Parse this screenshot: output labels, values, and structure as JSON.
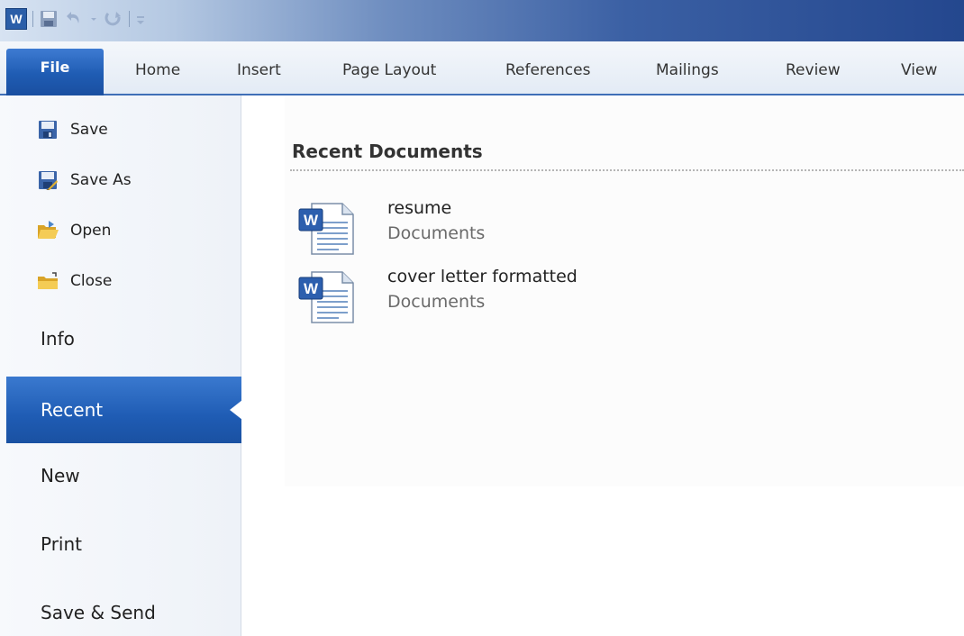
{
  "app": {
    "logo_letter": "W"
  },
  "ribbon": {
    "tabs": [
      {
        "label": "File"
      },
      {
        "label": "Home"
      },
      {
        "label": "Insert"
      },
      {
        "label": "Page Layout"
      },
      {
        "label": "References"
      },
      {
        "label": "Mailings"
      },
      {
        "label": "Review"
      },
      {
        "label": "View"
      }
    ]
  },
  "backstage": {
    "commands": [
      {
        "label": "Save",
        "icon": "save-icon"
      },
      {
        "label": "Save As",
        "icon": "save-as-icon"
      },
      {
        "label": "Open",
        "icon": "open-folder-icon"
      },
      {
        "label": "Close",
        "icon": "close-folder-icon"
      }
    ],
    "nav": [
      {
        "label": "Info"
      },
      {
        "label": "Recent",
        "selected": true
      },
      {
        "label": "New"
      },
      {
        "label": "Print"
      },
      {
        "label": "Save & Send"
      }
    ]
  },
  "recent": {
    "title": "Recent Documents",
    "documents": [
      {
        "name": "resume",
        "location": "Documents"
      },
      {
        "name": "cover letter formatted",
        "location": "Documents"
      }
    ]
  },
  "colors": {
    "accent": "#1f5cb3",
    "titlebar_dark": "#24478e"
  }
}
